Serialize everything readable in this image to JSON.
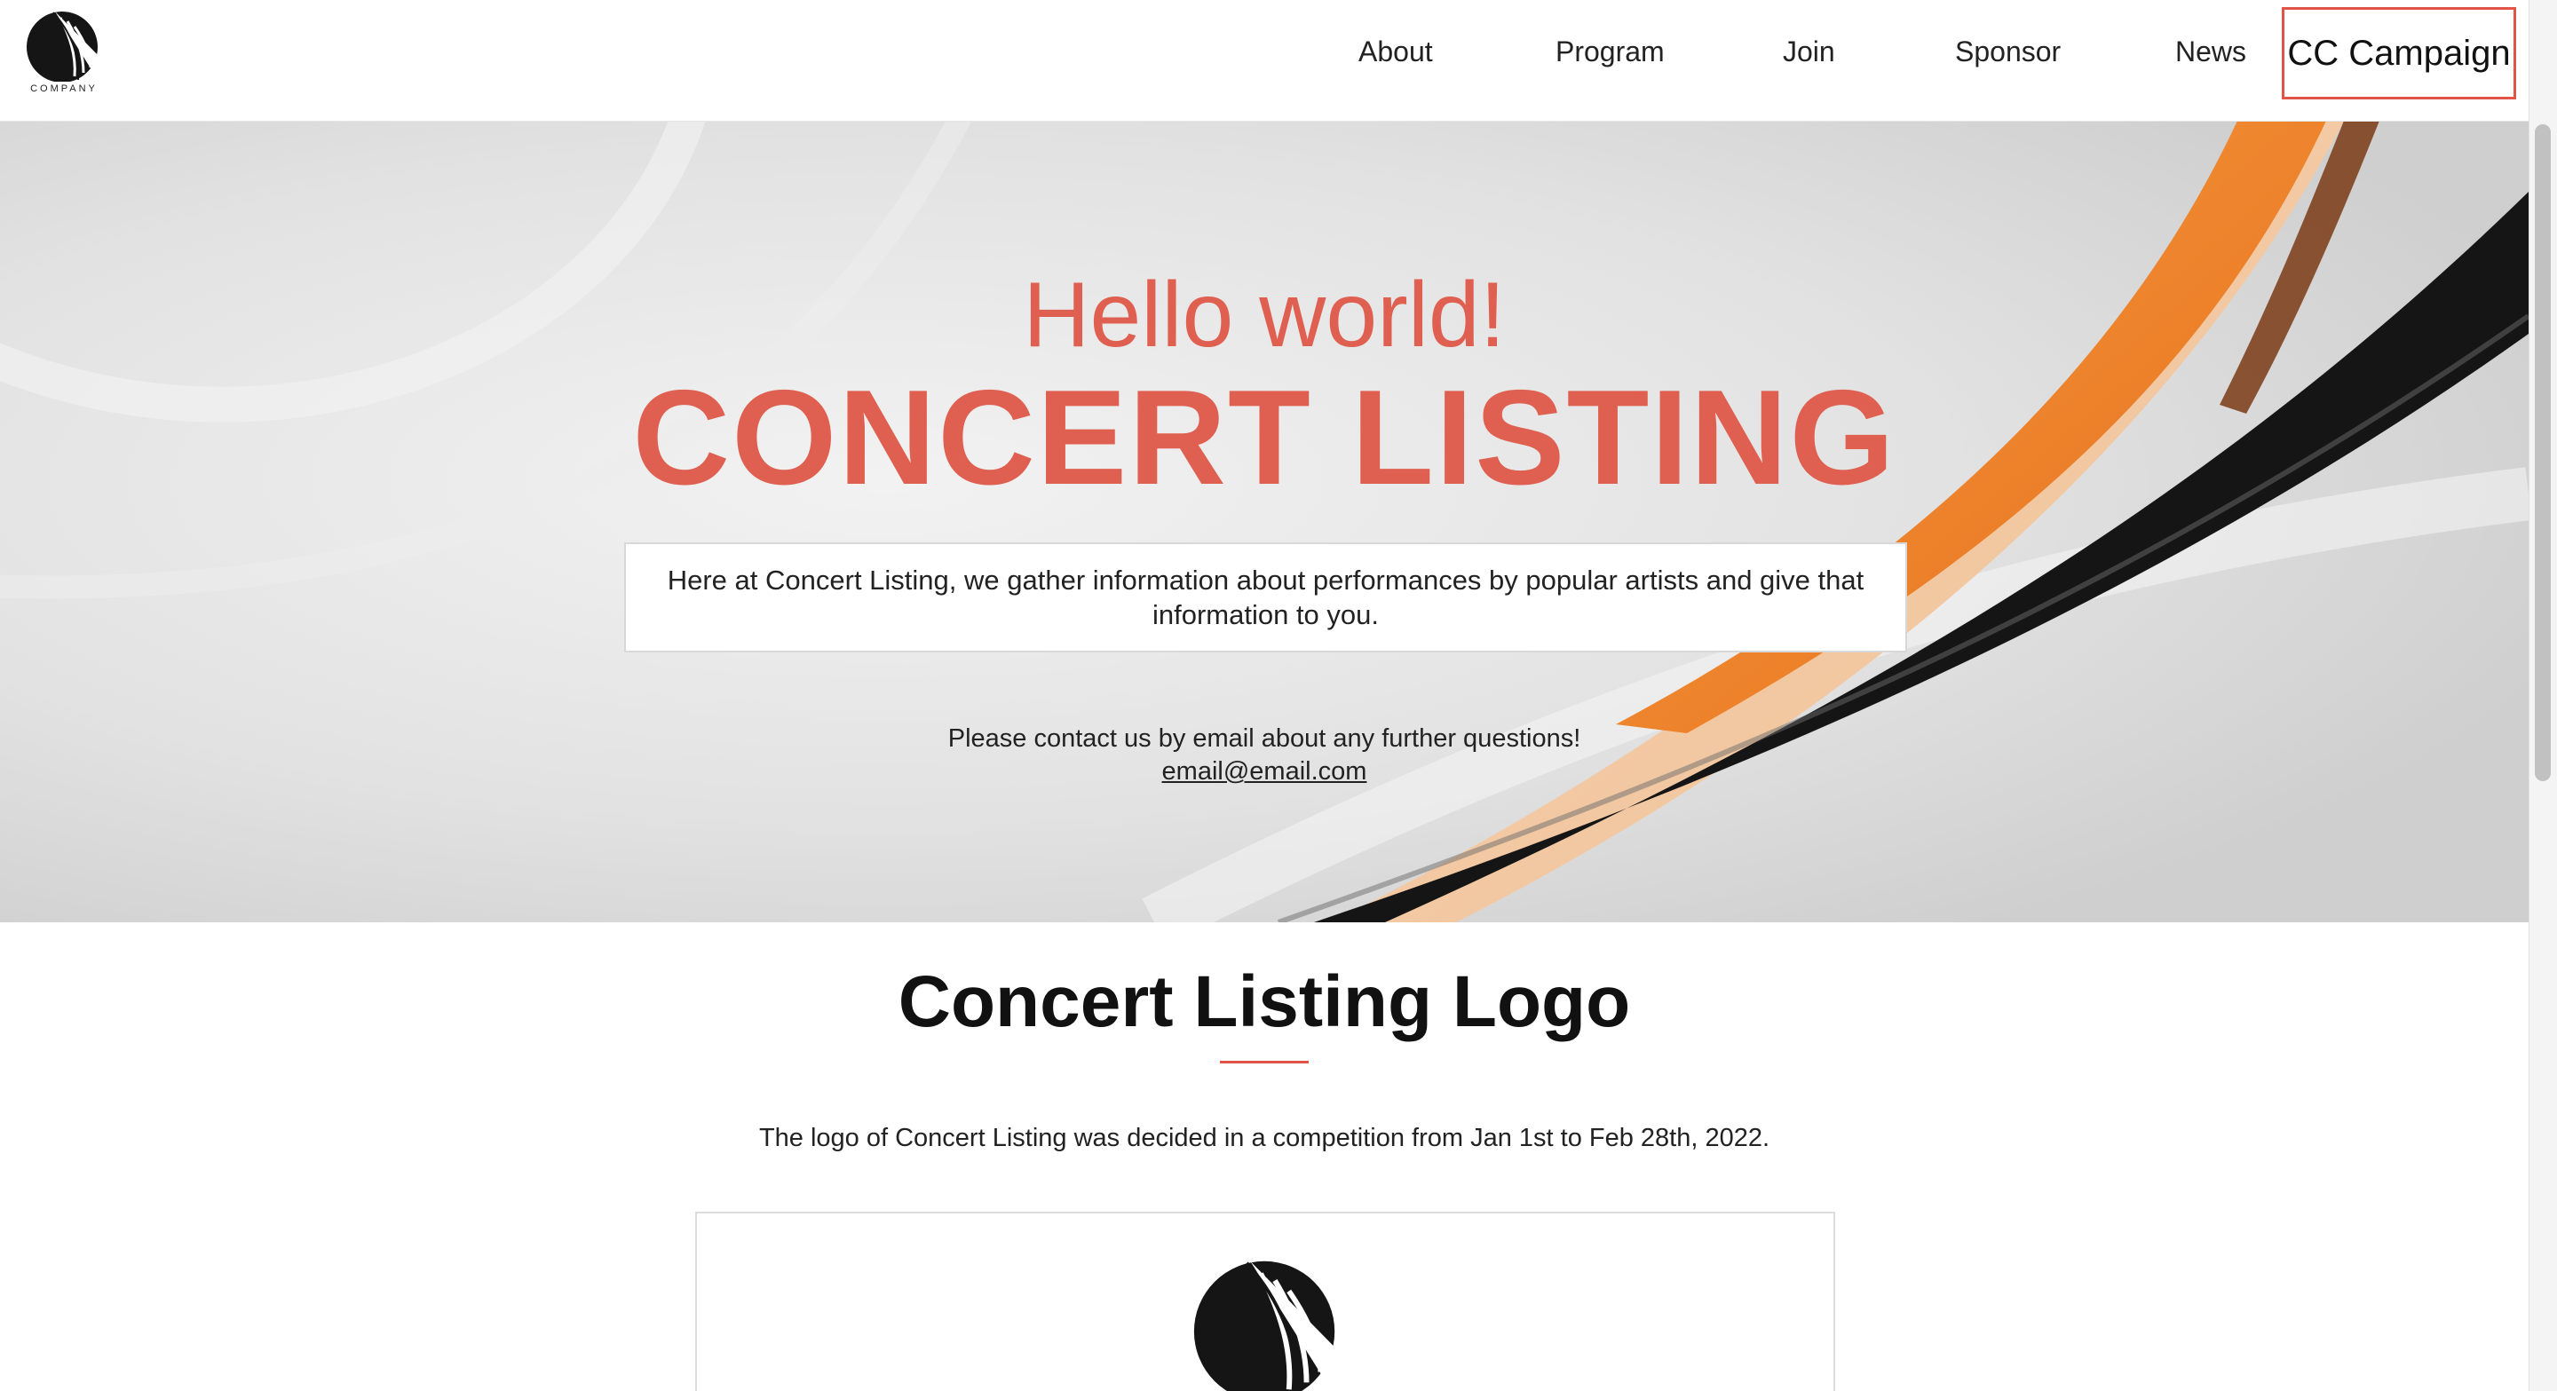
{
  "header": {
    "logo_text": "COMPANY",
    "nav": {
      "about": "About",
      "program": "Program",
      "join": "Join",
      "sponsor": "Sponsor",
      "news": "News",
      "cc_campaign": "CC Campaign"
    }
  },
  "hero": {
    "greeting": "Hello world!",
    "title": "CONCERT LISTING",
    "intro": "Here at Concert Listing, we gather information about performances by popular artists and give that information to you.",
    "contact_text": "Please contact us by email about any further questions!",
    "contact_email": "email@email.com"
  },
  "logo_section": {
    "title": "Concert Listing Logo",
    "description": "The logo of Concert Listing was decided in a competition from Jan 1st to Feb 28th, 2022."
  },
  "colors": {
    "accent": "#e0544a",
    "hero_text": "#df6050",
    "orange_swoosh": "#ef7f2a",
    "black_swoosh": "#151515"
  },
  "icons": {
    "logo": "company-logo-icon"
  }
}
